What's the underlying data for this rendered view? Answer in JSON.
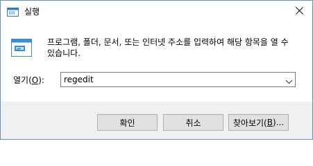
{
  "window": {
    "title": "실행",
    "icon": "run-dialog-icon",
    "close_icon": "close-icon"
  },
  "body": {
    "description": "프로그램, 폴더, 문서, 또는 인터넷 주소를 입력하여 해당 항목을 열 수 있습니다.",
    "icon": "run-dialog-icon"
  },
  "open_field": {
    "label_prefix": "열기(",
    "label_hotkey": "O",
    "label_suffix": "):",
    "value": "regedit",
    "dropdown_icon": "chevron-down-icon"
  },
  "buttons": {
    "ok": "확인",
    "cancel": "취소",
    "browse_prefix": "찾아보기(",
    "browse_hotkey": "B",
    "browse_suffix": ")..."
  },
  "colors": {
    "window_border": "#6d8fb5",
    "footer_bg": "#f0f0f0",
    "button_bg": "#e1e1e1",
    "button_border": "#adadad",
    "input_border": "#7a7a7a",
    "icon_blue": "#3c8cd6"
  }
}
